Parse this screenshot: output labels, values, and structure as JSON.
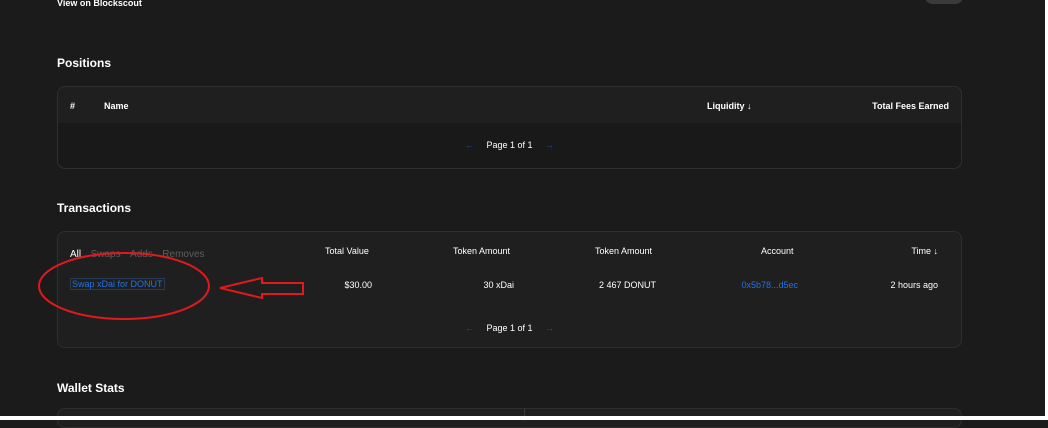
{
  "top": {
    "blockscout_link": "View on Blockscout"
  },
  "positions": {
    "title": "Positions",
    "columns": {
      "index": "#",
      "name": "Name",
      "liquidity": "Liquidity ↓",
      "fees": "Total Fees Earned"
    },
    "pager": {
      "prev": "←",
      "label": "Page 1 of 1",
      "next": "→"
    }
  },
  "transactions": {
    "title": "Transactions",
    "filters": {
      "all": "All",
      "swaps": "Swaps",
      "adds": "Adds",
      "removes": "Removes"
    },
    "columns": {
      "total_value": "Total Value",
      "token_amount_1": "Token Amount",
      "token_amount_2": "Token Amount",
      "account": "Account",
      "time": "Time ↓"
    },
    "rows": [
      {
        "action": "Swap xDai for DONUT",
        "total_value": "$30.00",
        "token_amount_1": "30 xDai",
        "token_amount_2": "2 467 DONUT",
        "account": "0x5b78...d5ec",
        "time": "2 hours ago"
      }
    ],
    "pager": {
      "prev": "←",
      "label": "Page 1 of 1",
      "next": "→"
    }
  },
  "wallet_stats": {
    "title": "Wallet Stats"
  },
  "colors": {
    "background": "#1b1b1b",
    "card": "#1f1f1f",
    "link": "#2172e5",
    "annotation": "#e0191e"
  },
  "annotation": {
    "shapes": [
      "ellipse-around-swap-link",
      "arrow-pointing-left"
    ]
  }
}
